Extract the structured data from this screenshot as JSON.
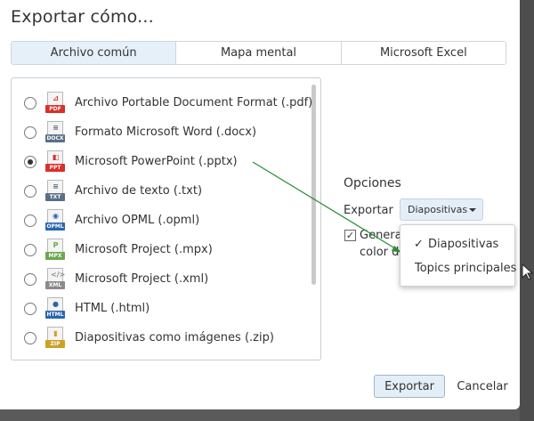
{
  "dialog": {
    "title": "Exportar cómo..."
  },
  "tabs": [
    {
      "label": "Archivo común",
      "active": true
    },
    {
      "label": "Mapa mental",
      "active": false
    },
    {
      "label": "Microsoft Excel",
      "active": false
    }
  ],
  "formats": [
    {
      "label": "Archivo Portable Document Format (.pdf)",
      "tag": "PDF",
      "icon": "pdf-file-icon",
      "color": "#d9302b",
      "glyph": "⊿",
      "selected": false
    },
    {
      "label": "Formato Microsoft Word (.docx)",
      "tag": "DOCX",
      "icon": "docx-file-icon",
      "color": "#5a6f86",
      "glyph": "≡",
      "selected": false
    },
    {
      "label": "Microsoft PowerPoint (.pptx)",
      "tag": "PPT",
      "icon": "pptx-file-icon",
      "color": "#d9302b",
      "glyph": "◧",
      "selected": true
    },
    {
      "label": "Archivo de texto (.txt)",
      "tag": "TXT",
      "icon": "txt-file-icon",
      "color": "#5a6f86",
      "glyph": "≡",
      "selected": false
    },
    {
      "label": "Archivo OPML (.opml)",
      "tag": "OPML",
      "icon": "opml-file-icon",
      "color": "#2a66b0",
      "glyph": "◉",
      "selected": false
    },
    {
      "label": "Microsoft Project (.mpx)",
      "tag": "MPX",
      "icon": "mpx-file-icon",
      "color": "#6aa84f",
      "glyph": "P",
      "selected": false
    },
    {
      "label": "Microsoft Project (.xml)",
      "tag": "XML",
      "icon": "xml-file-icon",
      "color": "#8a8a8a",
      "glyph": "</>",
      "selected": false
    },
    {
      "label": "HTML (.html)",
      "tag": "HTML",
      "icon": "html-file-icon",
      "color": "#2a66b0",
      "glyph": "●",
      "selected": false
    },
    {
      "label": "Diapositivas como imágenes (.zip)",
      "tag": "ZIP",
      "icon": "zip-file-icon",
      "color": "#c9a227",
      "glyph": "▮",
      "selected": false
    }
  ],
  "options": {
    "title": "Opciones",
    "export_label": "Exportar",
    "export_select_value": "Diapositivas",
    "checkbox_line1": "Genera",
    "checkbox_line2": "color de",
    "checkbox_checked": true
  },
  "dropdown": {
    "items": [
      {
        "label": "Diapositivas",
        "checked": true,
        "check_mark": "✓"
      },
      {
        "label": "Topics principales",
        "checked": false
      }
    ]
  },
  "buttons": {
    "export": "Exportar",
    "cancel": "Cancelar"
  },
  "colors": {
    "accent_tab": "#e6f0f8",
    "arrow": "#2f8f3a"
  }
}
